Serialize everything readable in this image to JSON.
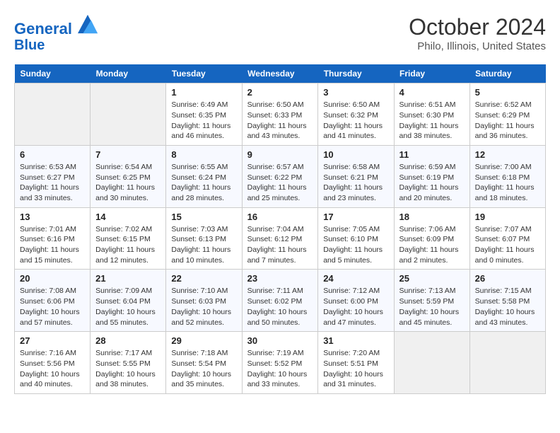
{
  "header": {
    "logo_line1": "General",
    "logo_line2": "Blue",
    "title": "October 2024",
    "subtitle": "Philo, Illinois, United States"
  },
  "days_of_week": [
    "Sunday",
    "Monday",
    "Tuesday",
    "Wednesday",
    "Thursday",
    "Friday",
    "Saturday"
  ],
  "weeks": [
    [
      {
        "num": "",
        "detail": ""
      },
      {
        "num": "",
        "detail": ""
      },
      {
        "num": "1",
        "detail": "Sunrise: 6:49 AM\nSunset: 6:35 PM\nDaylight: 11 hours and 46 minutes."
      },
      {
        "num": "2",
        "detail": "Sunrise: 6:50 AM\nSunset: 6:33 PM\nDaylight: 11 hours and 43 minutes."
      },
      {
        "num": "3",
        "detail": "Sunrise: 6:50 AM\nSunset: 6:32 PM\nDaylight: 11 hours and 41 minutes."
      },
      {
        "num": "4",
        "detail": "Sunrise: 6:51 AM\nSunset: 6:30 PM\nDaylight: 11 hours and 38 minutes."
      },
      {
        "num": "5",
        "detail": "Sunrise: 6:52 AM\nSunset: 6:29 PM\nDaylight: 11 hours and 36 minutes."
      }
    ],
    [
      {
        "num": "6",
        "detail": "Sunrise: 6:53 AM\nSunset: 6:27 PM\nDaylight: 11 hours and 33 minutes."
      },
      {
        "num": "7",
        "detail": "Sunrise: 6:54 AM\nSunset: 6:25 PM\nDaylight: 11 hours and 30 minutes."
      },
      {
        "num": "8",
        "detail": "Sunrise: 6:55 AM\nSunset: 6:24 PM\nDaylight: 11 hours and 28 minutes."
      },
      {
        "num": "9",
        "detail": "Sunrise: 6:57 AM\nSunset: 6:22 PM\nDaylight: 11 hours and 25 minutes."
      },
      {
        "num": "10",
        "detail": "Sunrise: 6:58 AM\nSunset: 6:21 PM\nDaylight: 11 hours and 23 minutes."
      },
      {
        "num": "11",
        "detail": "Sunrise: 6:59 AM\nSunset: 6:19 PM\nDaylight: 11 hours and 20 minutes."
      },
      {
        "num": "12",
        "detail": "Sunrise: 7:00 AM\nSunset: 6:18 PM\nDaylight: 11 hours and 18 minutes."
      }
    ],
    [
      {
        "num": "13",
        "detail": "Sunrise: 7:01 AM\nSunset: 6:16 PM\nDaylight: 11 hours and 15 minutes."
      },
      {
        "num": "14",
        "detail": "Sunrise: 7:02 AM\nSunset: 6:15 PM\nDaylight: 11 hours and 12 minutes."
      },
      {
        "num": "15",
        "detail": "Sunrise: 7:03 AM\nSunset: 6:13 PM\nDaylight: 11 hours and 10 minutes."
      },
      {
        "num": "16",
        "detail": "Sunrise: 7:04 AM\nSunset: 6:12 PM\nDaylight: 11 hours and 7 minutes."
      },
      {
        "num": "17",
        "detail": "Sunrise: 7:05 AM\nSunset: 6:10 PM\nDaylight: 11 hours and 5 minutes."
      },
      {
        "num": "18",
        "detail": "Sunrise: 7:06 AM\nSunset: 6:09 PM\nDaylight: 11 hours and 2 minutes."
      },
      {
        "num": "19",
        "detail": "Sunrise: 7:07 AM\nSunset: 6:07 PM\nDaylight: 11 hours and 0 minutes."
      }
    ],
    [
      {
        "num": "20",
        "detail": "Sunrise: 7:08 AM\nSunset: 6:06 PM\nDaylight: 10 hours and 57 minutes."
      },
      {
        "num": "21",
        "detail": "Sunrise: 7:09 AM\nSunset: 6:04 PM\nDaylight: 10 hours and 55 minutes."
      },
      {
        "num": "22",
        "detail": "Sunrise: 7:10 AM\nSunset: 6:03 PM\nDaylight: 10 hours and 52 minutes."
      },
      {
        "num": "23",
        "detail": "Sunrise: 7:11 AM\nSunset: 6:02 PM\nDaylight: 10 hours and 50 minutes."
      },
      {
        "num": "24",
        "detail": "Sunrise: 7:12 AM\nSunset: 6:00 PM\nDaylight: 10 hours and 47 minutes."
      },
      {
        "num": "25",
        "detail": "Sunrise: 7:13 AM\nSunset: 5:59 PM\nDaylight: 10 hours and 45 minutes."
      },
      {
        "num": "26",
        "detail": "Sunrise: 7:15 AM\nSunset: 5:58 PM\nDaylight: 10 hours and 43 minutes."
      }
    ],
    [
      {
        "num": "27",
        "detail": "Sunrise: 7:16 AM\nSunset: 5:56 PM\nDaylight: 10 hours and 40 minutes."
      },
      {
        "num": "28",
        "detail": "Sunrise: 7:17 AM\nSunset: 5:55 PM\nDaylight: 10 hours and 38 minutes."
      },
      {
        "num": "29",
        "detail": "Sunrise: 7:18 AM\nSunset: 5:54 PM\nDaylight: 10 hours and 35 minutes."
      },
      {
        "num": "30",
        "detail": "Sunrise: 7:19 AM\nSunset: 5:52 PM\nDaylight: 10 hours and 33 minutes."
      },
      {
        "num": "31",
        "detail": "Sunrise: 7:20 AM\nSunset: 5:51 PM\nDaylight: 10 hours and 31 minutes."
      },
      {
        "num": "",
        "detail": ""
      },
      {
        "num": "",
        "detail": ""
      }
    ]
  ]
}
